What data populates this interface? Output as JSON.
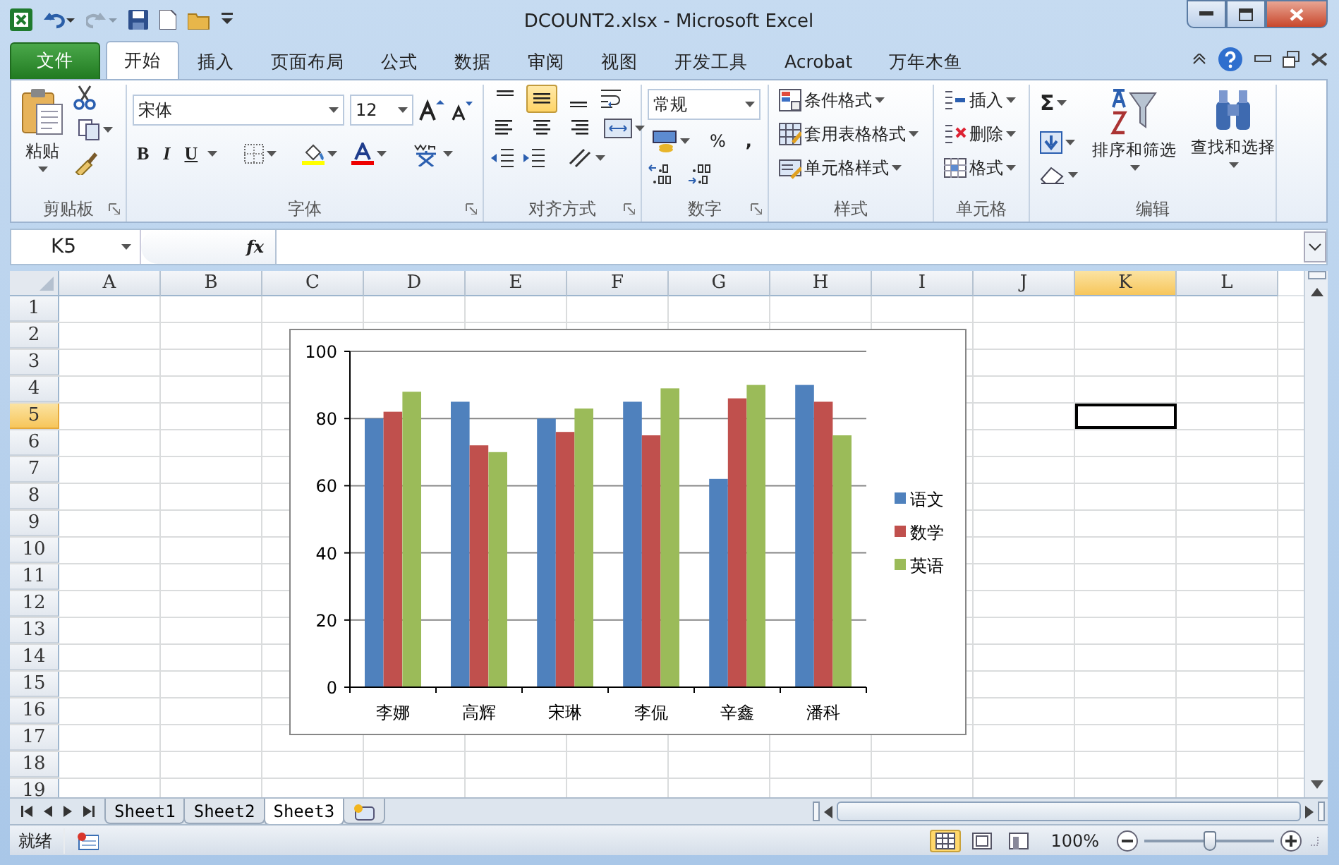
{
  "window": {
    "title": "DCOUNT2.xlsx  -  Microsoft Excel"
  },
  "tabs": [
    {
      "label": "文件",
      "kind": "file",
      "selected": false
    },
    {
      "label": "开始",
      "kind": "tab",
      "selected": true
    },
    {
      "label": "插入",
      "kind": "tab",
      "selected": false
    },
    {
      "label": "页面布局",
      "kind": "tab",
      "selected": false
    },
    {
      "label": "公式",
      "kind": "tab",
      "selected": false
    },
    {
      "label": "数据",
      "kind": "tab",
      "selected": false
    },
    {
      "label": "审阅",
      "kind": "tab",
      "selected": false
    },
    {
      "label": "视图",
      "kind": "tab",
      "selected": false
    },
    {
      "label": "开发工具",
      "kind": "tab",
      "selected": false
    },
    {
      "label": "Acrobat",
      "kind": "tab",
      "selected": false
    },
    {
      "label": "万年木鱼",
      "kind": "tab",
      "selected": false
    }
  ],
  "ribbon": {
    "clipboard": {
      "paste": "粘贴",
      "label": "剪贴板"
    },
    "font": {
      "name": "宋体",
      "size": "12",
      "bold": "B",
      "italic": "I",
      "underline": "U",
      "label": "字体"
    },
    "alignment": {
      "vertical_align": [
        {
          "selected": false
        },
        {
          "selected": true
        },
        {
          "selected": false
        }
      ],
      "label": "对齐方式"
    },
    "number": {
      "format": "常规",
      "percent": "%",
      "comma": ",",
      "label": "数字"
    },
    "styles": {
      "items": [
        "条件格式",
        "套用表格格式",
        "单元格样式"
      ],
      "label": "样式"
    },
    "cells": {
      "items": [
        "插入",
        "删除",
        "格式"
      ],
      "label": "单元格"
    },
    "editing": {
      "sum": "Σ",
      "sort": "排序和筛选",
      "find": "查找和选择",
      "label": "编辑"
    }
  },
  "formula_bar": {
    "name_box": "K5",
    "fx": "fx"
  },
  "sheet": {
    "columns": [
      {
        "label": "A",
        "selected": false
      },
      {
        "label": "B",
        "selected": false
      },
      {
        "label": "C",
        "selected": false
      },
      {
        "label": "D",
        "selected": false
      },
      {
        "label": "E",
        "selected": false
      },
      {
        "label": "F",
        "selected": false
      },
      {
        "label": "G",
        "selected": false
      },
      {
        "label": "H",
        "selected": false
      },
      {
        "label": "I",
        "selected": false
      },
      {
        "label": "J",
        "selected": false
      },
      {
        "label": "K",
        "selected": true
      },
      {
        "label": "L",
        "selected": false
      }
    ],
    "rows": [
      {
        "label": "1",
        "selected": false
      },
      {
        "label": "2",
        "selected": false
      },
      {
        "label": "3",
        "selected": false
      },
      {
        "label": "4",
        "selected": false
      },
      {
        "label": "5",
        "selected": true
      },
      {
        "label": "6",
        "selected": false
      },
      {
        "label": "7",
        "selected": false
      },
      {
        "label": "8",
        "selected": false
      },
      {
        "label": "9",
        "selected": false
      },
      {
        "label": "10",
        "selected": false
      },
      {
        "label": "11",
        "selected": false
      },
      {
        "label": "12",
        "selected": false
      },
      {
        "label": "13",
        "selected": false
      },
      {
        "label": "14",
        "selected": false
      },
      {
        "label": "15",
        "selected": false
      },
      {
        "label": "16",
        "selected": false
      },
      {
        "label": "17",
        "selected": false
      },
      {
        "label": "18",
        "selected": false
      },
      {
        "label": "19",
        "selected": false
      }
    ]
  },
  "chart": {
    "chart_data": {
      "type": "bar",
      "categories": [
        "李娜",
        "高辉",
        "宋琳",
        "李侃",
        "辛鑫",
        "潘科"
      ],
      "series": [
        {
          "name": "语文",
          "color": "#4f81bd",
          "values": [
            80,
            85,
            80,
            85,
            62,
            90
          ]
        },
        {
          "name": "数学",
          "color": "#c0504d",
          "values": [
            82,
            72,
            76,
            75,
            86,
            85
          ]
        },
        {
          "name": "英语",
          "color": "#9bbb59",
          "values": [
            88,
            70,
            83,
            89,
            90,
            75
          ]
        }
      ],
      "ylim": [
        0,
        100
      ],
      "yticks": [
        0,
        20,
        40,
        60,
        80,
        100
      ],
      "grid": true,
      "legend": true
    }
  },
  "sheet_tabs": [
    {
      "label": "Sheet1",
      "selected": false
    },
    {
      "label": "Sheet2",
      "selected": false
    },
    {
      "label": "Sheet3",
      "selected": true
    }
  ],
  "status_bar": {
    "status": "就绪",
    "views": [
      {
        "selected": true
      },
      {
        "selected": false
      },
      {
        "selected": false
      }
    ],
    "zoom": "100%",
    "zoom_slider": {
      "level": 0.5
    }
  }
}
